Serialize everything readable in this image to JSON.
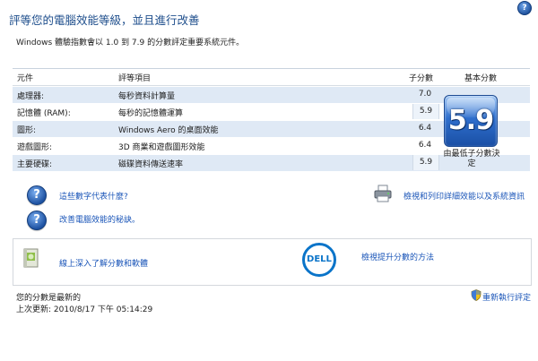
{
  "header": {
    "title": "評等您的電腦效能等級，並且進行改善",
    "description": "Windows 體驗指數會以 1.0 到 7.9 的分數評定重要系統元件。",
    "help_glyph": "?"
  },
  "table": {
    "headers": {
      "component": "元件",
      "rated": "評等項目",
      "subscore": "子分數",
      "basescore": "基本分數"
    },
    "rows": [
      {
        "component": "處理器:",
        "rated": "每秒資料計算量",
        "subscore": "7.0"
      },
      {
        "component": "記憶體 (RAM):",
        "rated": "每秒的記憶體運算",
        "subscore": "5.9"
      },
      {
        "component": "圖形:",
        "rated": "Windows Aero 的桌面效能",
        "subscore": "6.4"
      },
      {
        "component": "遊戲圖形:",
        "rated": "3D 商業和遊戲圖形效能",
        "subscore": "6.4"
      },
      {
        "component": "主要硬碟:",
        "rated": "磁碟資料傳送速率",
        "subscore": "5.9"
      }
    ],
    "base_score": "5.9",
    "base_caption": "由最低子分數決定"
  },
  "links": {
    "what_mean": "這些數字代表什麼?",
    "tips": "改善電腦效能的秘訣。",
    "print": "檢視和列印詳細效能以及系統資訊",
    "online": "線上深入了解分數和軟體",
    "improve": "檢視提升分數的方法"
  },
  "promo": {
    "brand_text": "DELL"
  },
  "status": {
    "current": "您的分數是最新的",
    "last_update": "上次更新: 2010/8/17 下午 05:14:29",
    "rerun": "重新執行評定"
  },
  "colors": {
    "title": "#1e4e8c",
    "link": "#1a55b8",
    "row_shade": "#dfe9f5",
    "score_blue": "#2f6fcd",
    "dell_blue": "#0a74c9"
  }
}
